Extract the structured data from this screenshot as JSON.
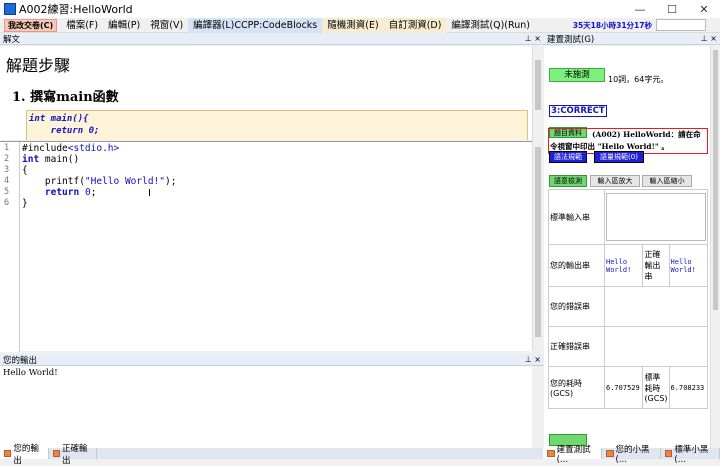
{
  "window": {
    "title": "A002練習:HelloWorld"
  },
  "menubar": {
    "leave_button": "我改交卷(C)",
    "items": [
      "檔案(F)",
      "編輯(P)",
      "視窗(V)",
      "編譯器(L)CCPP:CodeBlocks",
      "隨機測資(E)",
      "自訂測資(D)",
      "編譯測試(Q)(Run)"
    ],
    "timer": "35天18小時31分17秒"
  },
  "doc_panel": {
    "title": "解文",
    "heading": "解題步驟",
    "step": "1.  撰寫main函數",
    "code_lines": [
      "int main(){",
      "    return 0;"
    ]
  },
  "editor": {
    "line_numbers": [
      "1",
      "2",
      "3",
      "4",
      "5",
      "6"
    ]
  },
  "output_panel": {
    "title": "您的輸出",
    "text": "Hello World!"
  },
  "bottom_tabs": {
    "left": [
      "您的輸出",
      "正確輸出"
    ],
    "right": [
      "建置測試(...",
      "您的小黑(...",
      "標準小黑(..."
    ]
  },
  "right_panel": {
    "title": "建置測試(G)",
    "status_button": "未施測",
    "stats": "10詞，64字元。",
    "result": "3:CORRECT",
    "problem_button": "題目資料",
    "problem_text": "(A002) HelloWorld：請在命令視窗中印出 \"Hello World!\" 。",
    "btn_rules": "語法規範",
    "btn_topics": "語量規範(0)",
    "btn_check": "語意檢測",
    "btn_zoom_in": "輸入區放大",
    "btn_zoom_out": "輸入區縮小",
    "stdin_label": "標準輸入串",
    "your_output_label": "您的輸出串",
    "your_output_value": "Hello World!",
    "correct_output_label": "正確輸出串",
    "correct_output_value": "Hello World!",
    "your_error_label": "您的錯誤串",
    "correct_error_label": "正確錯誤串",
    "your_time_label": "您的耗時(GCS)",
    "your_time_value": "6.707529",
    "std_time_label": "標準耗時(GCS)",
    "std_time_value": "6.708233"
  }
}
